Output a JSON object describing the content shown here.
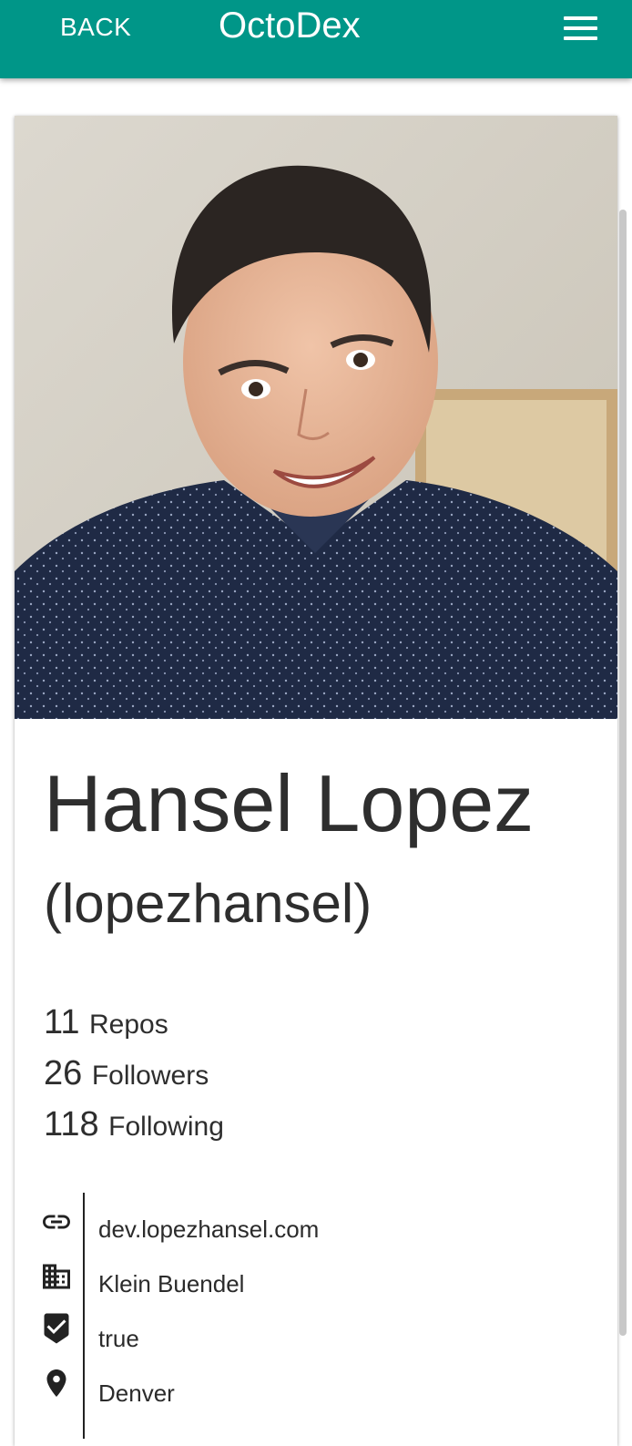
{
  "topbar": {
    "back_label": "BACK",
    "app_title": "OctoDex",
    "background_color": "#009688"
  },
  "profile": {
    "name": "Hansel Lopez",
    "login": "(lopezhansel)",
    "photo": "profile-photo-smiling-man-navy-shirt"
  },
  "stats": [
    {
      "value": "11",
      "label": "Repos"
    },
    {
      "value": "26",
      "label": "Followers"
    },
    {
      "value": "118",
      "label": "Following"
    }
  ],
  "info": [
    {
      "icon": "link-icon",
      "text": "dev.lopezhansel.com"
    },
    {
      "icon": "company-icon",
      "text": "Klein Buendel"
    },
    {
      "icon": "verified-icon",
      "text": "true"
    },
    {
      "icon": "location-icon",
      "text": "Denver"
    }
  ]
}
